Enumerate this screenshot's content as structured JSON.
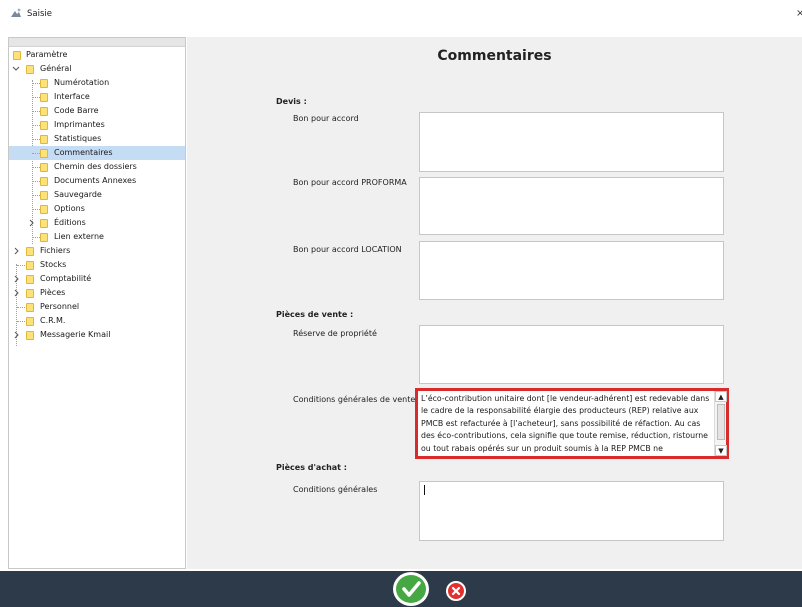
{
  "window": {
    "title": "Saisie",
    "close_glyph": "×",
    "icon": "app-icon"
  },
  "tree": {
    "items": [
      {
        "label": "Paramètre",
        "level": 0
      },
      {
        "label": "Général",
        "level": 0,
        "expanded": true
      },
      {
        "label": "Numérotation",
        "level": 1
      },
      {
        "label": "Interface",
        "level": 1
      },
      {
        "label": "Code Barre",
        "level": 1
      },
      {
        "label": "Imprimantes",
        "level": 1
      },
      {
        "label": "Statistiques",
        "level": 1
      },
      {
        "label": "Commentaires",
        "level": 1,
        "selected": true
      },
      {
        "label": "Chemin des dossiers",
        "level": 1
      },
      {
        "label": "Documents Annexes",
        "level": 1
      },
      {
        "label": "Sauvegarde",
        "level": 1
      },
      {
        "label": "Options",
        "level": 1
      },
      {
        "label": "Éditions",
        "level": 1,
        "collapsed": true
      },
      {
        "label": "Lien externe",
        "level": 1
      },
      {
        "label": "Fichiers",
        "level": 0,
        "collapsed": true
      },
      {
        "label": "Stocks",
        "level": 0
      },
      {
        "label": "Comptabilité",
        "level": 0,
        "collapsed": true
      },
      {
        "label": "Pièces",
        "level": 0,
        "collapsed": true
      },
      {
        "label": "Personnel",
        "level": 0
      },
      {
        "label": "C.R.M.",
        "level": 0
      },
      {
        "label": "Messagerie Kmail",
        "level": 0,
        "collapsed": true
      }
    ]
  },
  "main": {
    "title": "Commentaires",
    "devis": {
      "section": "Devis :",
      "accord_label": "Bon pour accord",
      "accord_value": "",
      "proforma_label": "Bon pour accord PROFORMA",
      "proforma_value": "",
      "location_label": "Bon pour accord LOCATION",
      "location_value": ""
    },
    "pieces_vente": {
      "section": "Pièces de vente :",
      "reserve_label": "Réserve de propriété",
      "reserve_value": "",
      "conditions_label": "Conditions générales de vente",
      "conditions_value": "L’éco-contribution unitaire dont [le vendeur-adhérent] est redevable dans le cadre de la responsabilité élargie des producteurs (REP) relative aux PMCB est refacturée à [l’acheteur], sans possibilité de réfaction. Au cas des éco-contributions, cela signifie que toute remise, réduction, ristourne ou tout rabais opérés sur un produit soumis à la REP PMCB ne"
    },
    "pieces_achat": {
      "section": "Pièces d'achat :",
      "conditions_label": "Conditions générales",
      "conditions_value": ""
    }
  },
  "footer": {
    "ok_icon": "check-icon",
    "cancel_icon": "close-icon"
  },
  "colors": {
    "footer_bg": "#2c3a4a",
    "ok": "#46a843",
    "cancel": "#e0312e",
    "highlight": "#d92b2b",
    "selected_row": "#c5dcf5"
  }
}
